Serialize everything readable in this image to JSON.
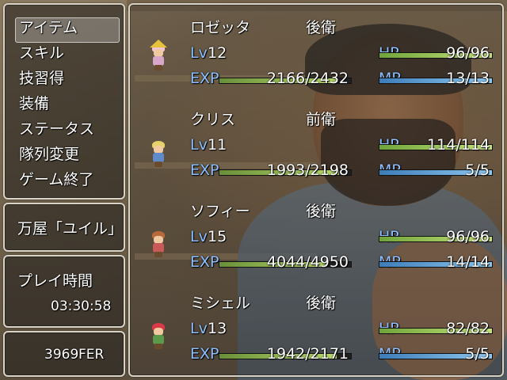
{
  "menu": {
    "items": [
      "アイテム",
      "スキル",
      "技習得",
      "装備",
      "ステータス",
      "隊列変更",
      "ゲーム終了"
    ],
    "selected_index": 0
  },
  "location": {
    "label": "万屋「ユイル」"
  },
  "playtime": {
    "label": "プレイ時間",
    "value": "03:30:58"
  },
  "gold": {
    "amount": "3969",
    "unit": "FER"
  },
  "labels": {
    "lv": "Lv",
    "exp": "EXP",
    "hp": "HP",
    "mp": "MP"
  },
  "party": [
    {
      "name": "ロゼッタ",
      "row": "後衛",
      "level": "12",
      "exp": "2166/2432",
      "hp": "96/96",
      "mp": "13/13",
      "exp_ratio": 0.89,
      "hp_ratio": 1.0,
      "mp_ratio": 1.0,
      "sprite": "rosetta-sprite"
    },
    {
      "name": "クリス",
      "row": "前衛",
      "level": "11",
      "exp": "1993/2198",
      "hp": "114/114",
      "mp": "5/5",
      "exp_ratio": 0.91,
      "hp_ratio": 1.0,
      "mp_ratio": 1.0,
      "sprite": "chris-sprite"
    },
    {
      "name": "ソフィー",
      "row": "後衛",
      "level": "15",
      "exp": "4044/4950",
      "hp": "96/96",
      "mp": "14/14",
      "exp_ratio": 0.82,
      "hp_ratio": 1.0,
      "mp_ratio": 1.0,
      "sprite": "sophie-sprite"
    },
    {
      "name": "ミシェル",
      "row": "後衛",
      "level": "13",
      "exp": "1942/2171",
      "hp": "82/82",
      "mp": "5/5",
      "exp_ratio": 0.89,
      "hp_ratio": 1.0,
      "mp_ratio": 1.0,
      "sprite": "michel-sprite"
    }
  ],
  "colors": {
    "window_border": "#d9d3c7",
    "label_blue": "#8ec0ff",
    "exp_gauge": "#b7d86a",
    "hp_gauge": "#c6e17a",
    "mp_gauge": "#8ec7ef"
  }
}
